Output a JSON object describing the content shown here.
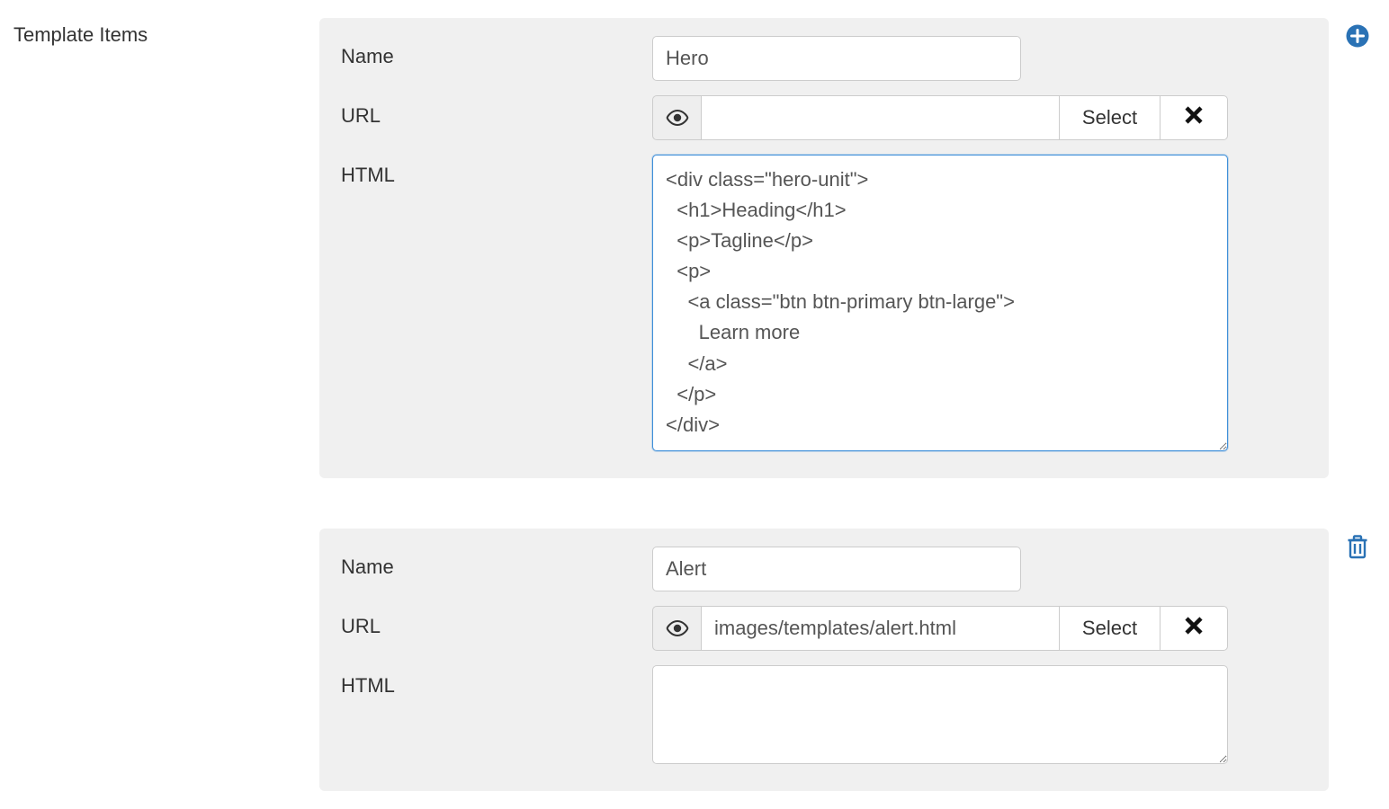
{
  "sectionLabel": "Template Items",
  "labels": {
    "name": "Name",
    "url": "URL",
    "html": "HTML"
  },
  "buttons": {
    "select": "Select"
  },
  "items": [
    {
      "name": "Hero",
      "url": "",
      "html": "<div class=\"hero-unit\">\n  <h1>Heading</h1>\n  <p>Tagline</p>\n  <p>\n    <a class=\"btn btn-primary btn-large\">\n      Learn more\n    </a>\n  </p>\n</div>",
      "htmlFocused": true,
      "action": "add"
    },
    {
      "name": "Alert",
      "url": "images/templates/alert.html",
      "html": "",
      "htmlFocused": false,
      "action": "delete"
    }
  ],
  "colors": {
    "accent": "#2a72b5"
  }
}
